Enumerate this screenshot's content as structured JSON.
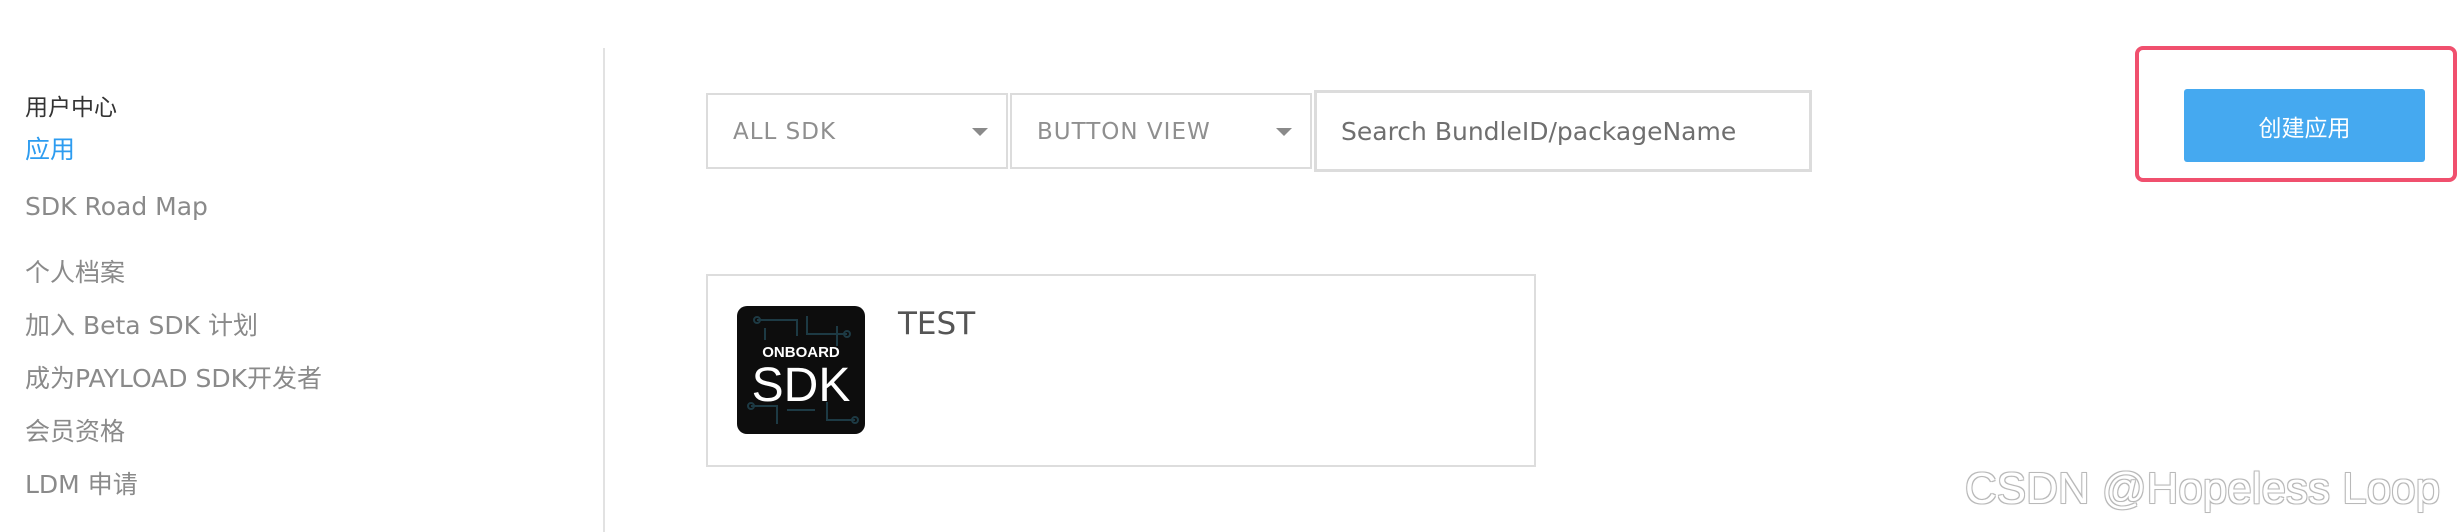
{
  "sidebar": {
    "heading": "用户中心",
    "items": [
      {
        "label": "应用",
        "active": true
      },
      {
        "label": "SDK Road Map",
        "active": false
      },
      {
        "label": "个人档案",
        "active": false
      },
      {
        "label": "加入 Beta SDK 计划",
        "active": false
      },
      {
        "label": "成为PAYLOAD SDK开发者",
        "active": false
      },
      {
        "label": "会员资格",
        "active": false
      },
      {
        "label": "LDM 申请",
        "active": false
      }
    ]
  },
  "toolbar": {
    "sdk_filter": {
      "selected": "ALL SDK",
      "icon": "caret-down-icon"
    },
    "view_filter": {
      "selected": "BUTTON VIEW",
      "icon": "caret-down-icon"
    },
    "search": {
      "placeholder": "Search BundleID/packageName",
      "value": ""
    }
  },
  "create_button": {
    "label": "创建应用"
  },
  "apps": [
    {
      "name": "TEST",
      "icon": {
        "small_text": "ONBOARD",
        "big_text": "SDK"
      }
    }
  ],
  "watermark": "CSDN @Hopeless Loop",
  "colors": {
    "accent": "#2d9cf0",
    "button": "#45a9f0",
    "highlight": "#f0506e"
  }
}
